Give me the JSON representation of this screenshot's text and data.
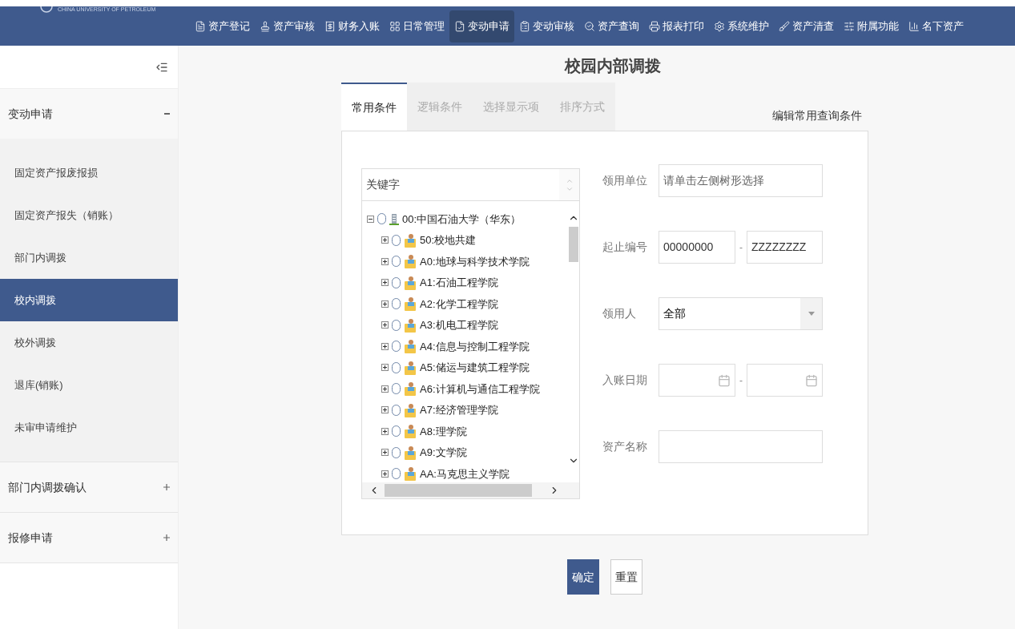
{
  "header": {
    "logo_text": "CHINA UNIVERSITY OF PETROLEUM",
    "nav": [
      {
        "label": "资产登记",
        "selected": false
      },
      {
        "label": "资产审核",
        "selected": false
      },
      {
        "label": "财务入账",
        "selected": false
      },
      {
        "label": "日常管理",
        "selected": false
      },
      {
        "label": "变动申请",
        "selected": true
      },
      {
        "label": "变动审核",
        "selected": false
      },
      {
        "label": "资产查询",
        "selected": false
      },
      {
        "label": "报表打印",
        "selected": false
      },
      {
        "label": "系统维护",
        "selected": false
      },
      {
        "label": "资产清查",
        "selected": false
      },
      {
        "label": "附属功能",
        "selected": false
      },
      {
        "label": "名下资产",
        "selected": false
      }
    ]
  },
  "sidebar": {
    "groups": [
      {
        "label": "变动申请",
        "expanded": true,
        "items": [
          {
            "label": "固定资产报废报损",
            "selected": false
          },
          {
            "label": "固定资产报失（销账）",
            "selected": false
          },
          {
            "label": "部门内调拨",
            "selected": false
          },
          {
            "label": "校内调拨",
            "selected": true
          },
          {
            "label": "校外调拨",
            "selected": false
          },
          {
            "label": "退库(销账)",
            "selected": false
          },
          {
            "label": "未审申请维护",
            "selected": false
          }
        ]
      },
      {
        "label": "部门内调拨确认",
        "expanded": false
      },
      {
        "label": "报修申请",
        "expanded": false
      }
    ]
  },
  "page_title": "校园内部调拨",
  "tabs": [
    {
      "label": "常用条件",
      "selected": true
    },
    {
      "label": "逻辑条件",
      "selected": false
    },
    {
      "label": "选择显示项",
      "selected": false
    },
    {
      "label": "排序方式",
      "selected": false
    }
  ],
  "edit_link": "编辑常用查询条件",
  "tree": {
    "search_placeholder": "关键字",
    "nodes": [
      {
        "label": "00:中国石油大学（华东）",
        "kind": "root",
        "expanded": true,
        "selected": false,
        "children": [
          {
            "label": "50:校地共建",
            "kind": "dept",
            "expanded": false,
            "selected": false
          },
          {
            "label": "A0:地球与科学技术学院",
            "kind": "dept",
            "expanded": false,
            "selected": false
          },
          {
            "label": "A1:石油工程学院",
            "kind": "dept",
            "expanded": false,
            "selected": false
          },
          {
            "label": "A2:化学工程学院",
            "kind": "dept",
            "expanded": false,
            "selected": false
          },
          {
            "label": "A3:机电工程学院",
            "kind": "dept",
            "expanded": false,
            "selected": false
          },
          {
            "label": "A4:信息与控制工程学院",
            "kind": "dept",
            "expanded": false,
            "selected": false
          },
          {
            "label": "A5:储运与建筑工程学院",
            "kind": "dept",
            "expanded": false,
            "selected": false
          },
          {
            "label": "A6:计算机与通信工程学院",
            "kind": "dept",
            "expanded": false,
            "selected": false
          },
          {
            "label": "A7:经济管理学院",
            "kind": "dept",
            "expanded": false,
            "selected": false
          },
          {
            "label": "A8:理学院",
            "kind": "dept",
            "expanded": false,
            "selected": false
          },
          {
            "label": "A9:文学院",
            "kind": "dept",
            "expanded": false,
            "selected": false
          },
          {
            "label": "AA:马克思主义学院",
            "kind": "dept",
            "expanded": false,
            "selected": false
          }
        ]
      }
    ]
  },
  "form": [
    {
      "label": "领用单位",
      "kind": "text",
      "placeholder": "请单击左侧树形选择"
    },
    {
      "label": "起止编号",
      "kind": "range",
      "from": "00000000",
      "separator": "-",
      "to": "ZZZZZZZZ"
    },
    {
      "label": "领用人",
      "kind": "select",
      "value": "全部"
    },
    {
      "label": "入账日期",
      "kind": "date_range",
      "separator": "-"
    },
    {
      "label": "资产名称",
      "kind": "text"
    }
  ],
  "buttons": [
    {
      "label": "确定",
      "kind": "primary"
    },
    {
      "label": "重置",
      "kind": "secondary"
    }
  ]
}
